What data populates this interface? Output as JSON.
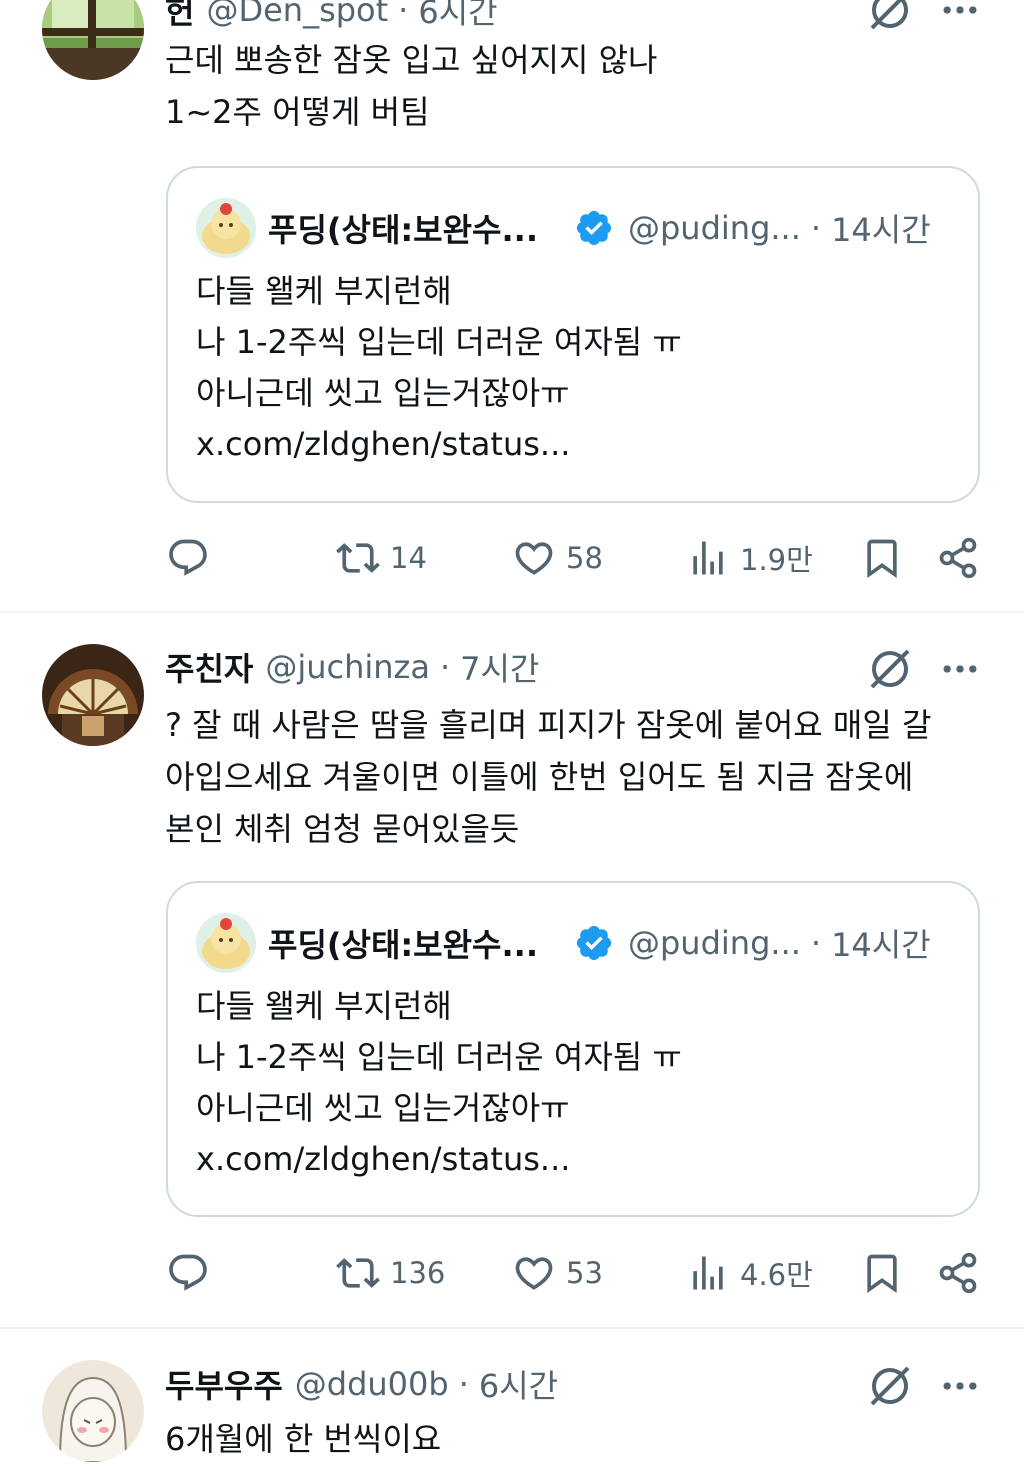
{
  "tweets": [
    {
      "name": "헌",
      "handle": "@Den_spot",
      "time": "6시간",
      "text": "근데 뽀송한 잠옷 입고 싶어지지 않나\n1~2주 어떻게 버팀",
      "quote": {
        "name": "푸딩(상태:보완수...",
        "handle": "@puding...",
        "time": "14시간",
        "text": "다들 왤케 부지런해\n나 1-2주씩 입는데 더러운 여자됨 ㅠ\n아니근데 씻고 입는거잖아ㅠ\nx.com/zldghen/status..."
      },
      "stats": {
        "retweets": "14",
        "likes": "58",
        "views": "1.9만"
      }
    },
    {
      "name": "주친자",
      "handle": "@juchinza",
      "time": "7시간",
      "text": "? 잘 때 사람은 땀을 흘리며 피지가 잠옷에 붙어요 매일 갈\n아입으세요 겨울이면 이틀에 한번 입어도 됨 지금 잠옷에\n본인 체취 엄청 묻어있을듯",
      "quote": {
        "name": "푸딩(상태:보완수...",
        "handle": "@puding...",
        "time": "14시간",
        "text": "다들 왤케 부지런해\n나 1-2주씩 입는데 더러운 여자됨 ㅠ\n아니근데 씻고 입는거잖아ㅠ\nx.com/zldghen/status..."
      },
      "stats": {
        "retweets": "136",
        "likes": "53",
        "views": "4.6만"
      }
    },
    {
      "name": "두부우주",
      "handle": "@ddu00b",
      "time": "6시간",
      "text": "6개월에 한 번씩이요"
    }
  ],
  "separator": "·",
  "icons": {
    "reply": "reply-icon",
    "retweet": "retweet-icon",
    "like": "heart-icon",
    "views": "views-icon",
    "bookmark": "bookmark-icon",
    "share": "share-icon",
    "grok": "grok-icon",
    "more": "more-icon",
    "verified": "verified-badge-icon"
  },
  "colors": {
    "text": "#0f1419",
    "secondary": "#536471",
    "border": "#cfd9de",
    "divider": "#eff3f4",
    "verified": "#1d9bf0"
  }
}
